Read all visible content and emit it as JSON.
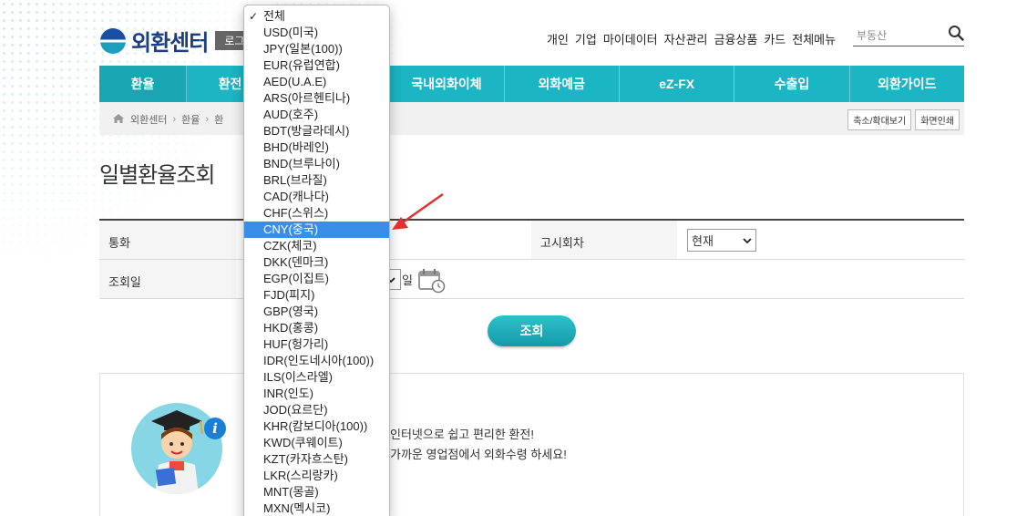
{
  "header": {
    "logo_text": "외환센터",
    "login_label": "로그",
    "util_nav": [
      "개인",
      "기업",
      "마이데이터",
      "자산관리",
      "금융상품",
      "카드",
      "전체메뉴"
    ],
    "search_placeholder": "부동산"
  },
  "gnb": {
    "tabs": [
      "환율",
      "환전",
      "",
      "국내외화이체",
      "외화예금",
      "eZ-FX",
      "수출입",
      "외환가이드"
    ]
  },
  "breadcrumb": {
    "items": [
      "외환센터",
      "환율",
      "환"
    ],
    "buttons": [
      "축소/확대보기",
      "화면인쇄"
    ]
  },
  "page": {
    "title": "일별환율조회"
  },
  "form": {
    "currency_label": "통화",
    "notice_label": "고시회차",
    "notice_value": "현재",
    "date_label": "조회일",
    "day_suffix": "일",
    "submit_label": "조회"
  },
  "info": {
    "icon_label": "i",
    "line1": "인터넷으로 쉽고 편리한 환전!",
    "line2": "가까운 영업점에서 외화수령 하세요!"
  },
  "dropdown": {
    "selected_index": 0,
    "highlighted_index": 13,
    "options": [
      "전체",
      "USD(미국)",
      "JPY(일본(100))",
      "EUR(유럽연합)",
      "AED(U.A.E)",
      "ARS(아르헨티나)",
      "AUD(호주)",
      "BDT(방글라데시)",
      "BHD(바레인)",
      "BND(브루나이)",
      "BRL(브라질)",
      "CAD(캐나다)",
      "CHF(스위스)",
      "CNY(중국)",
      "CZK(체코)",
      "DKK(덴마크)",
      "EGP(이집트)",
      "FJD(피지)",
      "GBP(영국)",
      "HKD(홍콩)",
      "HUF(헝가리)",
      "IDR(인도네시아(100))",
      "ILS(이스라엘)",
      "INR(인도)",
      "JOD(요르단)",
      "KHR(캄보디아(100))",
      "KWD(쿠웨이트)",
      "KZT(카자흐스탄)",
      "LKR(스리랑카)",
      "MNT(몽골)",
      "MXN(멕시코)"
    ]
  },
  "colors": {
    "accent": "#1cb5c3",
    "highlight": "#3b8ee8",
    "arrow": "#e53030"
  }
}
